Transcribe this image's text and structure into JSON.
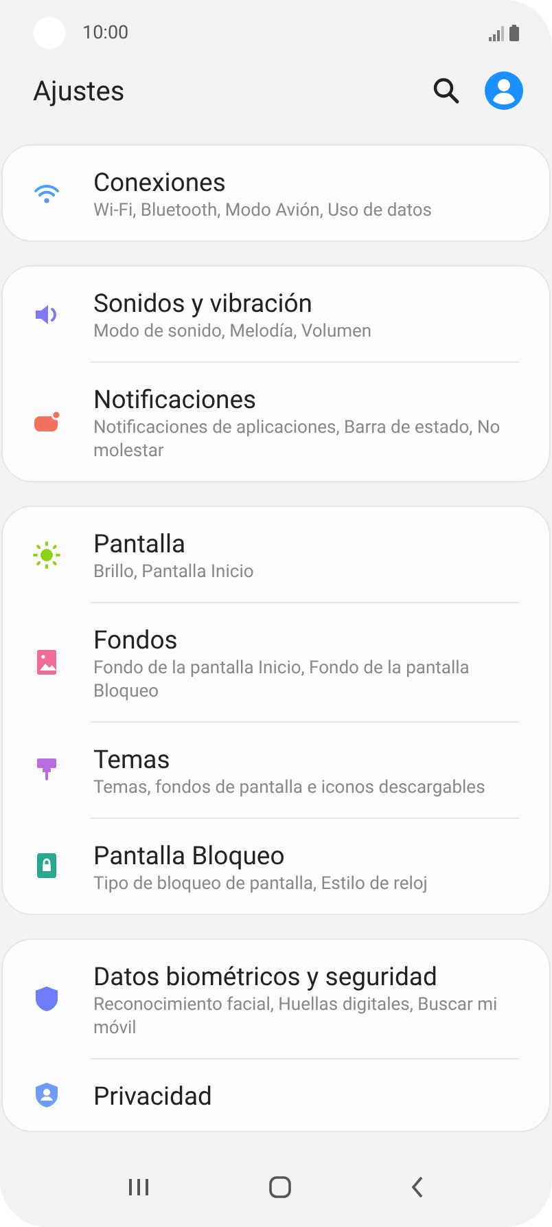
{
  "status_bar": {
    "time": "10:00"
  },
  "header": {
    "title": "Ajustes"
  },
  "groups": [
    {
      "items": [
        {
          "kind": "wifi",
          "color": "#4d9cff",
          "title": "Conexiones",
          "subtitle": "Wi-Fi, Bluetooth, Modo Avión, Uso de datos"
        }
      ]
    },
    {
      "items": [
        {
          "kind": "sound",
          "color": "#8179f0",
          "title": "Sonidos y vibración",
          "subtitle": "Modo de sonido, Melodía, Volumen"
        },
        {
          "kind": "notification",
          "color": "#f2725e",
          "title": "Notificaciones",
          "subtitle": "Notificaciones de aplicaciones, Barra de estado, No molestar"
        }
      ]
    },
    {
      "items": [
        {
          "kind": "sun",
          "color": "#8fd114",
          "title": "Pantalla",
          "subtitle": "Brillo, Pantalla Inicio"
        },
        {
          "kind": "image",
          "color": "#ef6d93",
          "title": "Fondos",
          "subtitle": "Fondo de la pantalla Inicio, Fondo de la pantalla Bloqueo"
        },
        {
          "kind": "brush",
          "color": "#b86ddf",
          "title": "Temas",
          "subtitle": "Temas, fondos de pantalla e iconos descargables"
        },
        {
          "kind": "lock",
          "color": "#27a98f",
          "title": "Pantalla Bloqueo",
          "subtitle": "Tipo de bloqueo de pantalla, Estilo de reloj"
        }
      ]
    },
    {
      "items": [
        {
          "kind": "shield",
          "color": "#6f7cf7",
          "title": "Datos biométricos y seguridad",
          "subtitle": "Reconocimiento facial, Huellas digitales, Buscar mi móvil"
        },
        {
          "kind": "privacy",
          "color": "#6f9cf7",
          "title": "Privacidad"
        }
      ]
    }
  ]
}
